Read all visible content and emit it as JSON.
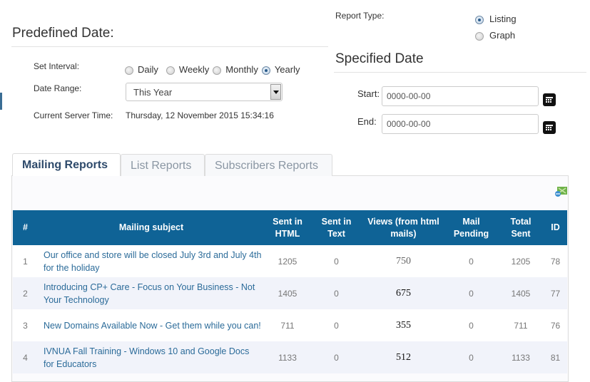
{
  "predefined": {
    "title": "Predefined Date:",
    "set_interval_label": "Set Interval:",
    "interval_options": [
      {
        "label": "Daily",
        "checked": false
      },
      {
        "label": "Weekly",
        "checked": false
      },
      {
        "label": "Monthly",
        "checked": false
      },
      {
        "label": "Yearly",
        "checked": true
      }
    ],
    "date_range_label": "Date Range:",
    "date_range_value": "This Year",
    "server_time_label": "Current Server Time:",
    "server_time_value": "Thursday, 12 November 2015 15:34:16"
  },
  "report_type": {
    "label": "Report Type:",
    "options": [
      {
        "label": "Listing",
        "checked": true
      },
      {
        "label": "Graph",
        "checked": false
      }
    ]
  },
  "specified": {
    "title": "Specified Date",
    "start_label": "Start:",
    "start_value": "0000-00-00",
    "end_label": "End:",
    "end_value": "0000-00-00"
  },
  "tabs": [
    {
      "label": "Mailing Reports",
      "active": true
    },
    {
      "label": "List Reports",
      "active": false
    },
    {
      "label": "Subscribers Reports",
      "active": false
    }
  ],
  "table": {
    "headers": [
      "#",
      "Mailing subject",
      "Sent in HTML",
      "Sent in Text",
      "Views (from html mails)",
      "Mail Pending",
      "Total Sent",
      "ID"
    ],
    "rows": [
      {
        "num": "1",
        "subject": "Our office and store will be closed July 3rd and July 4th for the holiday",
        "sent_html": "1205",
        "sent_text": "0",
        "views": "750",
        "pending": "0",
        "total": "1205",
        "id": "78"
      },
      {
        "num": "2",
        "subject": "Introducing CP+ Care - Focus on Your Business - Not Your Technology",
        "sent_html": "1405",
        "sent_text": "0",
        "views": "675",
        "pending": "0",
        "total": "1405",
        "id": "77"
      },
      {
        "num": "3",
        "subject": "New Domains Available Now - Get them while you can!",
        "sent_html": "711",
        "sent_text": "0",
        "views": "355",
        "pending": "0",
        "total": "711",
        "id": "76"
      },
      {
        "num": "4",
        "subject": "IVNUA Fall Training - Windows 10 and Google Docs for Educators",
        "sent_html": "1133",
        "sent_text": "0",
        "views": "512",
        "pending": "0",
        "total": "1133",
        "id": "81"
      }
    ]
  },
  "icons": {
    "calendar": "calendar-icon",
    "export": "excel-export-icon"
  },
  "colors": {
    "table_header": "#0f6396",
    "link": "#2b6b99",
    "active_tab": "#2e4a6b"
  }
}
